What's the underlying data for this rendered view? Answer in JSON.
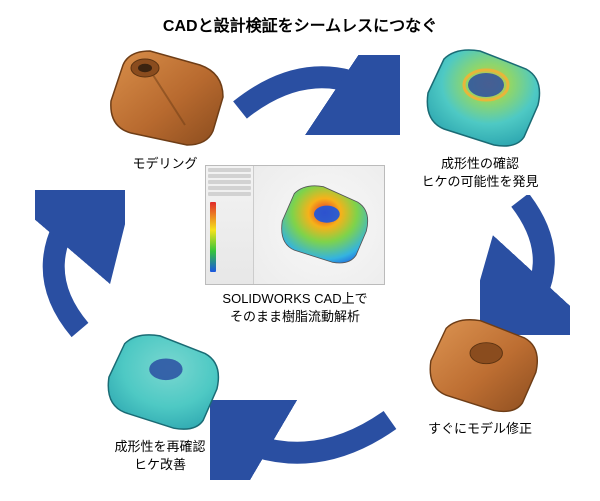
{
  "title": "CADと設計検証をシームレスにつなぐ",
  "steps": {
    "modeling": {
      "caption": "モデリング"
    },
    "molding_check": {
      "line1": "成形性の確認",
      "line2": "ヒケの可能性を発見"
    },
    "model_fix": {
      "caption": "すぐにモデル修正"
    },
    "recheck": {
      "line1": "成形性を再確認",
      "line2": "ヒケ改善"
    }
  },
  "center": {
    "line1": "SOLIDWORKS CAD上で",
    "line2": "そのまま樹脂流動解析"
  },
  "colors": {
    "arrow": "#2a4fa2",
    "cad_body": "#b86a2f",
    "cad_edge": "#6e3d16",
    "sim_body": "#4ec9c4",
    "sim_warm": "#e8b63a",
    "sim_edge": "#1a6b74"
  }
}
